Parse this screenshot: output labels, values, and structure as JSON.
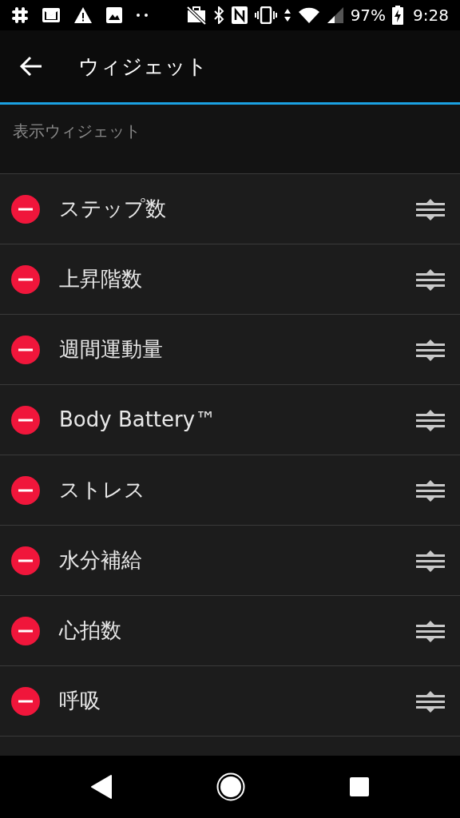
{
  "status_bar": {
    "battery": "97%",
    "time": "9:28"
  },
  "app_bar": {
    "title": "ウィジェット"
  },
  "section": {
    "title": "表示ウィジェット"
  },
  "widgets": [
    {
      "label": "ステップ数"
    },
    {
      "label": "上昇階数"
    },
    {
      "label": "週間運動量"
    },
    {
      "label": "Body Battery™"
    },
    {
      "label": "ストレス"
    },
    {
      "label": "水分補給"
    },
    {
      "label": "心拍数"
    },
    {
      "label": "呼吸"
    }
  ]
}
